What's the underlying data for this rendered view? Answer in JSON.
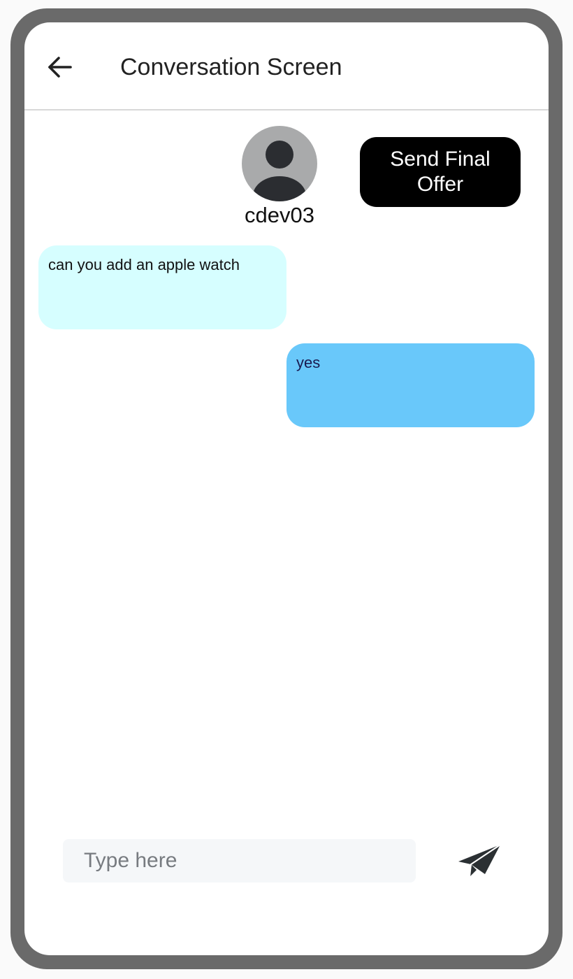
{
  "header": {
    "title": "Conversation Screen",
    "back_icon": "arrow-left-icon"
  },
  "contact": {
    "username": "cdev03",
    "avatar_icon": "person-silhouette-icon"
  },
  "actions": {
    "send_final_offer_label": "Send Final Offer"
  },
  "messages": [
    {
      "direction": "received",
      "text": "can you add an apple watch"
    },
    {
      "direction": "sent",
      "text": "yes"
    }
  ],
  "composer": {
    "placeholder": "Type here",
    "value": "",
    "send_icon": "paper-plane-icon"
  },
  "colors": {
    "frame": "#6a6a6a",
    "received_bubble": "#d6feff",
    "sent_bubble": "#69c8fa",
    "offer_button": "#000000",
    "avatar_bg": "#a9aaab"
  }
}
